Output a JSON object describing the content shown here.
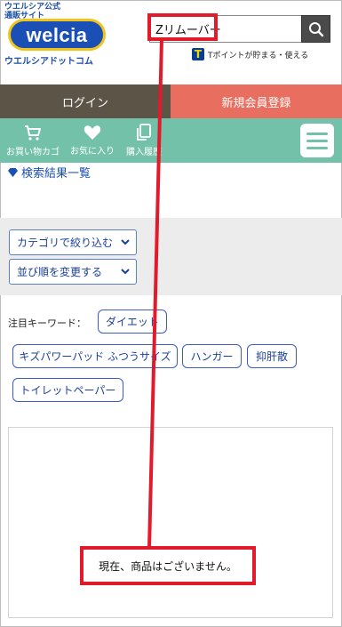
{
  "header": {
    "logo_top": "ウエルシア公式\n通販サイト",
    "logo_text": "welcia",
    "logo_sub": "ウエルシアドットコム",
    "search": {
      "value": "Zリムーバー",
      "placeholder": ""
    },
    "tpoint_icon": "T",
    "tpoint_text": "Tポイントが貯まる・使える"
  },
  "account": {
    "login_label": "ログイン",
    "register_label": "新規会員登録"
  },
  "nav": {
    "items": [
      {
        "label": "お買い物カゴ",
        "icon": "cart-icon"
      },
      {
        "label": "お気に入り",
        "icon": "heart-icon"
      },
      {
        "label": "購入履歴",
        "icon": "history-icon"
      }
    ],
    "menu_icon": "hamburger-icon"
  },
  "results_heading": "検索結果一覧",
  "filters": {
    "category_label": "カテゴリで絞り込む",
    "sort_label": "並び順を変更する"
  },
  "keywords": {
    "label": "注目キーワード：",
    "tags": [
      "ダイエット",
      "キズパワーパッド ふつうサイズ",
      "ハンガー",
      "抑肝散",
      "トイレットペーパー"
    ]
  },
  "empty_message": "現在、商品はございません。",
  "colors": {
    "login_bg": "#5b5447",
    "register_bg": "#e86f5f",
    "nav_bg": "#73c1a8",
    "brand_blue": "#1a4fb5",
    "annotation_red": "#e21b2c"
  }
}
